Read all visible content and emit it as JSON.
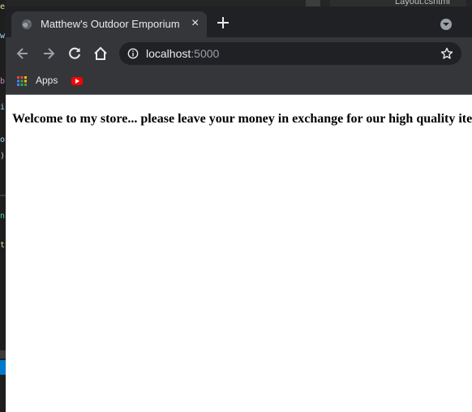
{
  "browser": {
    "tab": {
      "title": "Matthew's Outdoor Emporium",
      "close_icon": "×"
    },
    "address_bar": {
      "host": "localhost",
      "port": ":5000"
    },
    "bookmarks": {
      "apps_label": "Apps",
      "youtube_icon": "youtube-icon"
    }
  },
  "page": {
    "heading": "Welcome to my store... please leave your money in exchange for our high quality items"
  },
  "background_editor": {
    "tab_label": "Layout.cshtml"
  },
  "colors": {
    "chrome_dark": "#202124",
    "chrome_toolbar": "#35363a",
    "text_light": "#e8eaed",
    "text_dim": "#9aa0a6",
    "page_bg": "#ffffff"
  }
}
